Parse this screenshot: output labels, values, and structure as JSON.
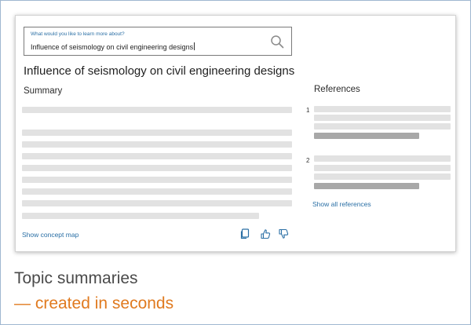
{
  "search": {
    "label": "What would you like to learn more about?",
    "value": "Influence of seismology on civil engineering designs"
  },
  "topic": {
    "title": "Influence of seismology on civil engineering designs"
  },
  "summary": {
    "heading": "Summary",
    "concept_map_link": "Show concept map"
  },
  "references": {
    "heading": "References",
    "items": [
      {
        "number": "1"
      },
      {
        "number": "2"
      }
    ],
    "show_all_link": "Show all references"
  },
  "actions": {
    "icons": [
      "copy-icon",
      "thumbs-up-icon",
      "thumbs-down-icon"
    ],
    "color": "#2a6fa5"
  },
  "caption": {
    "line1": "Topic summaries",
    "line2": "— created in seconds",
    "accent_color": "#e07a1f"
  }
}
